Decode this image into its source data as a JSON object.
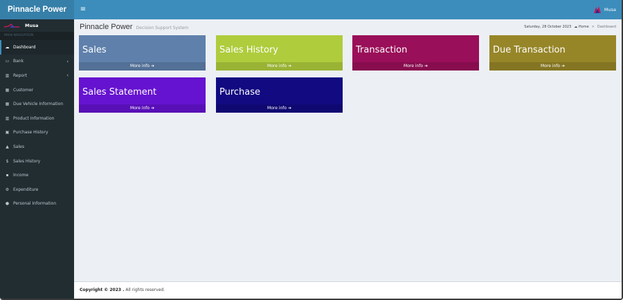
{
  "app": {
    "brand": "Pinnacle Power"
  },
  "topbar": {
    "menu_icon": "hamburger-icon",
    "username": "Musa"
  },
  "sidebar": {
    "user_name": "Musa",
    "section_label": "MAIN NAVIGATION",
    "items": [
      {
        "label": "Dashboard",
        "icon": "dashboard-icon",
        "glyph": "☁",
        "active": true
      },
      {
        "label": "Bank",
        "icon": "bank-icon",
        "glyph": "▭",
        "chevron": "‹"
      },
      {
        "label": "Report",
        "icon": "report-chart-icon",
        "glyph": "▥",
        "chevron": "‹"
      },
      {
        "label": "Customer",
        "icon": "customer-icon",
        "glyph": "▦"
      },
      {
        "label": "Due Vehicle Information",
        "icon": "grid-icon",
        "glyph": "▦"
      },
      {
        "label": "Product Information",
        "icon": "bar-chart-icon",
        "glyph": "▥"
      },
      {
        "label": "Purchase History",
        "icon": "cart-icon",
        "glyph": "▣"
      },
      {
        "label": "Sales",
        "icon": "area-chart-icon",
        "glyph": "▲"
      },
      {
        "label": "Sales History",
        "icon": "dollar-icon",
        "glyph": "$"
      },
      {
        "label": "Income",
        "icon": "cart-icon",
        "glyph": "▪"
      },
      {
        "label": "Expenditure",
        "icon": "gear-icon",
        "glyph": "⚙"
      },
      {
        "label": "Personal Information",
        "icon": "user-icon",
        "glyph": "●"
      }
    ]
  },
  "header": {
    "title": "Pinnacle Power",
    "subtitle": "Decision Support System",
    "date": "Saturday, 28 October 2023",
    "breadcrumb_home": "Home",
    "breadcrumb_sep": ">",
    "breadcrumb_current": "Dashboard"
  },
  "boxes": [
    {
      "title": "Sales",
      "footer": "More info ➔",
      "color": "#5f80ab"
    },
    {
      "title": "Sales History",
      "footer": "More info ➔",
      "color": "#afcc3d"
    },
    {
      "title": "Transaction",
      "footer": "More info ➔",
      "color": "#9a0f59"
    },
    {
      "title": "Due Transaction",
      "footer": "More info ➔",
      "color": "#978628"
    },
    {
      "title": "Sales Statement",
      "footer": "More info ➔",
      "color": "#6513d0"
    },
    {
      "title": "Purchase",
      "footer": "More info ➔",
      "color": "#120a81"
    }
  ],
  "footer": {
    "copyright": "Copyright © 2023 .",
    "rights": "All rights reserved."
  }
}
